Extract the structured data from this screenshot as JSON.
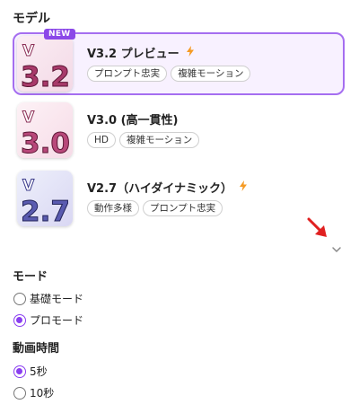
{
  "model_section": {
    "title": "モデル"
  },
  "models": [
    {
      "version_text": "3.2",
      "name": "V3.2 プレビュー",
      "badge": "NEW",
      "has_bolt": true,
      "tags": [
        "プロンプト忠実",
        "複雑モーション"
      ],
      "selected": true
    },
    {
      "version_text": "3.0",
      "name": "V3.0 (高一貫性)",
      "badge": "",
      "has_bolt": false,
      "tags": [
        "HD",
        "複雑モーション"
      ],
      "selected": false
    },
    {
      "version_text": "2.7",
      "name": "V2.7（ハイダイナミック）",
      "badge": "",
      "has_bolt": true,
      "tags": [
        "動作多様",
        "プロンプト忠実"
      ],
      "selected": false
    }
  ],
  "mode_section": {
    "title": "モード",
    "options": [
      {
        "label": "基礎モード",
        "checked": false
      },
      {
        "label": "プロモード",
        "checked": true
      }
    ]
  },
  "duration_section": {
    "title": "動画時間",
    "options": [
      {
        "label": "5秒",
        "checked": true
      },
      {
        "label": "10秒",
        "checked": false
      }
    ]
  },
  "colors": {
    "accent": "#8a3ef0",
    "selected_border": "#a56ef0",
    "bolt": "#f59a23",
    "arrow": "#e02020"
  },
  "icons": {
    "expand": "chevron-down-icon",
    "annotation": "red-arrow-icon",
    "bolt": "lightning-icon"
  }
}
